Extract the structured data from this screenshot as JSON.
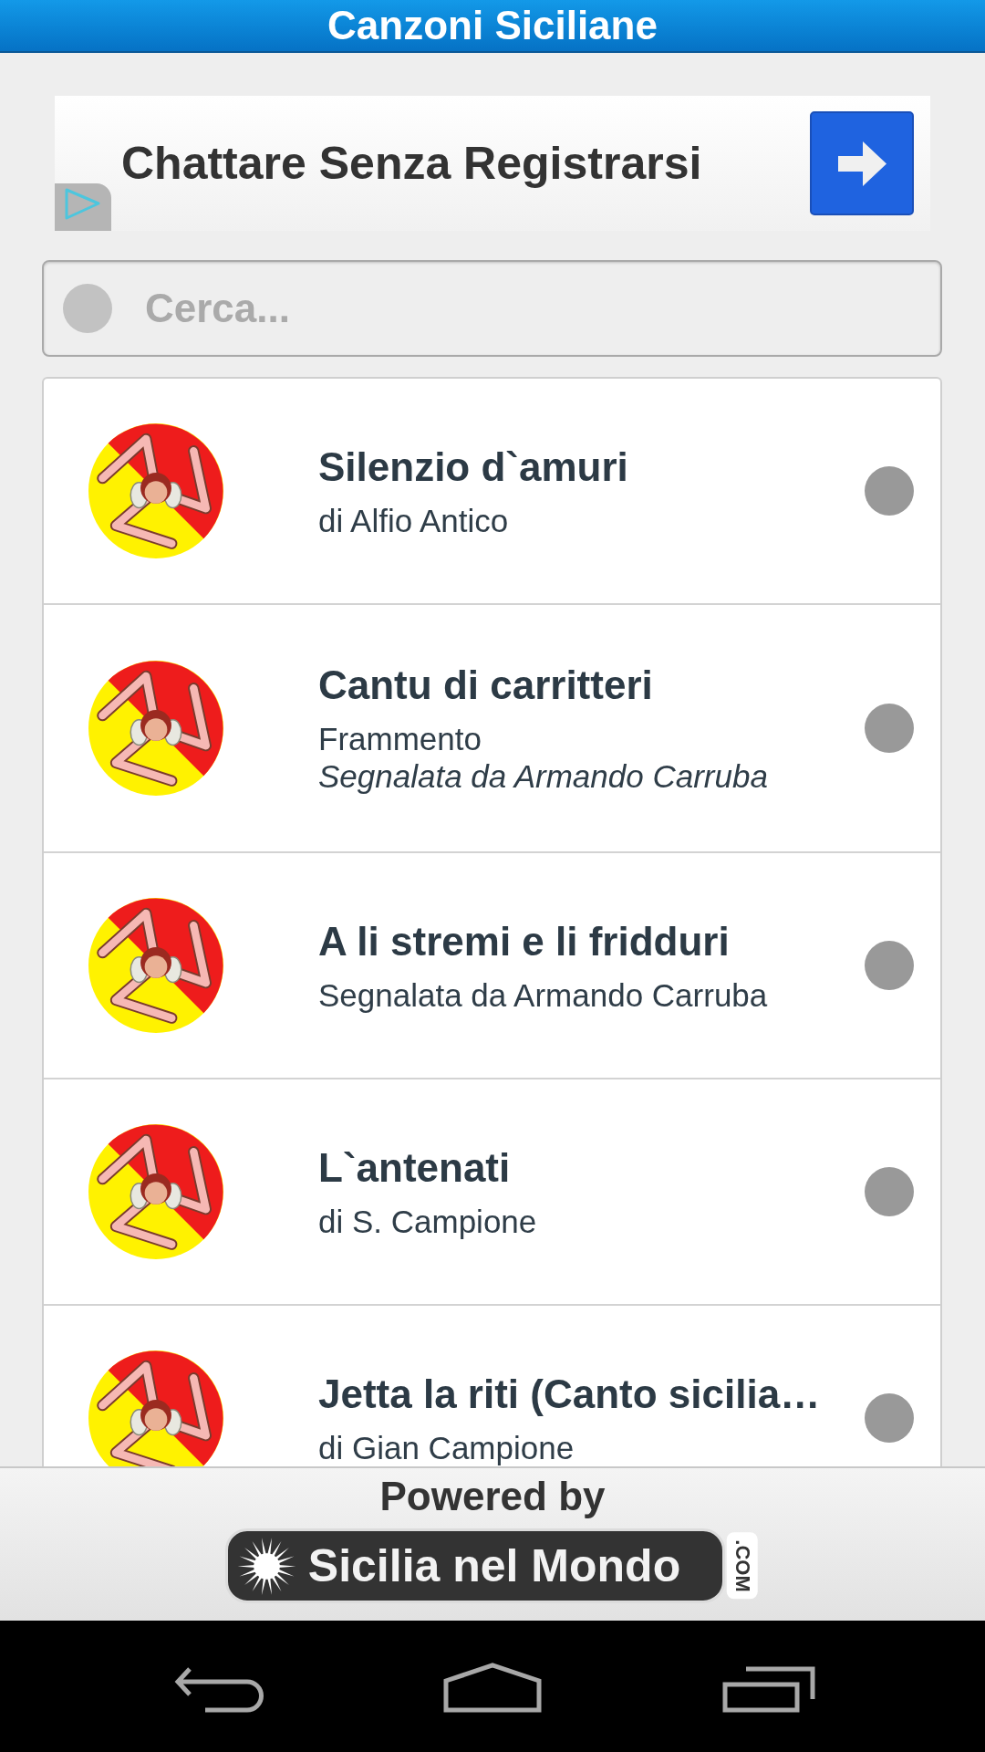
{
  "header": {
    "title": "Canzoni Siciliane"
  },
  "ad": {
    "headline": "Chattare Senza Registrarsi"
  },
  "search": {
    "placeholder": "Cerca..."
  },
  "songs": [
    {
      "title": "Silenzio d`amuri",
      "lines": [
        {
          "text": "di Alfio Antico",
          "italic": false
        }
      ]
    },
    {
      "title": "Cantu di carritteri",
      "lines": [
        {
          "text": "Frammento",
          "italic": false
        },
        {
          "text": "Segnalata da Armando Carruba",
          "italic": true
        }
      ]
    },
    {
      "title": "A li stremi e li fridduri",
      "lines": [
        {
          "text": "Segnalata da Armando Carruba",
          "italic": false
        }
      ]
    },
    {
      "title": "L`antenati",
      "lines": [
        {
          "text": "di S. Campione",
          "italic": false
        }
      ]
    },
    {
      "title": "Jetta la riti (Canto sicilia…",
      "lines": [
        {
          "text": "di Gian Campione",
          "italic": false
        }
      ]
    }
  ],
  "footer": {
    "caption": "Powered by",
    "logo_name": "Sicilia nel Mondo",
    "logo_domain": ".COM"
  }
}
